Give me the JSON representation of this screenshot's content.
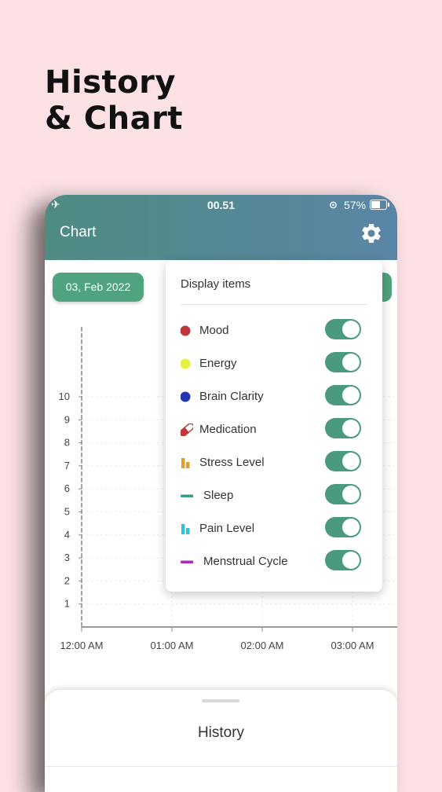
{
  "promo": {
    "line1": "History",
    "line2": "& Chart"
  },
  "status_bar": {
    "time": "00.51",
    "battery": "57%"
  },
  "app_bar": {
    "title": "Chart"
  },
  "date_chip": {
    "label": "03, Feb 2022"
  },
  "chart_data": {
    "type": "line",
    "yticks": [
      "1",
      "2",
      "3",
      "4",
      "5",
      "6",
      "7",
      "8",
      "9",
      "10"
    ],
    "xticks": [
      "12:00 AM",
      "01:00 AM",
      "02:00 AM",
      "03:00 AM"
    ],
    "ylim": [
      0,
      10
    ],
    "grid": true
  },
  "dropdown": {
    "header": "Display items",
    "items": [
      {
        "label": "Mood",
        "icon": "dot",
        "color": "#c0373a",
        "enabled": true
      },
      {
        "label": "Energy",
        "icon": "dot",
        "color": "#e9ef3e",
        "enabled": true
      },
      {
        "label": "Brain Clarity",
        "icon": "dot",
        "color": "#2336b0",
        "enabled": true
      },
      {
        "label": "Medication",
        "icon": "pill",
        "color": "#c0373a",
        "enabled": true
      },
      {
        "label": "Stress Level",
        "icon": "bars",
        "color": "#e2a21d",
        "enabled": true
      },
      {
        "label": "Sleep",
        "icon": "dash",
        "color": "#3f9a86",
        "enabled": true
      },
      {
        "label": "Pain Level",
        "icon": "bars",
        "color": "#2ec4d6",
        "enabled": true
      },
      {
        "label": "Menstrual Cycle",
        "icon": "dash",
        "color": "#b226c9",
        "enabled": true
      }
    ]
  },
  "history_sheet": {
    "title": "History"
  }
}
